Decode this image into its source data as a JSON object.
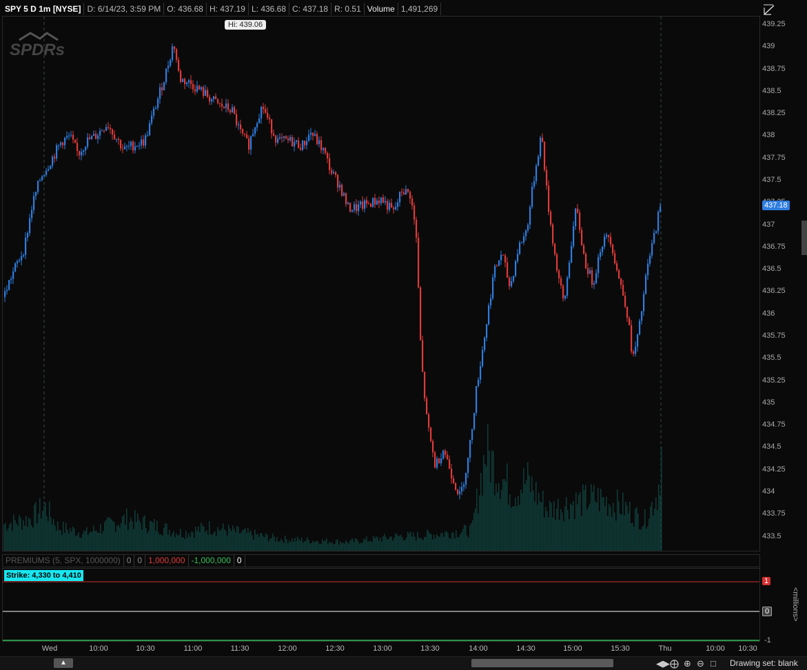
{
  "header": {
    "symbol": "SPY 5 D 1m [NYSE]",
    "date": "D: 6/14/23, 3:59 PM",
    "open": "O: 436.68",
    "high": "H: 437.19",
    "low": "L: 436.68",
    "close": "C: 437.18",
    "range": "R: 0.51",
    "volume_label": "Volume",
    "volume_value": "1,491,269"
  },
  "chart_data": {
    "type": "candlestick",
    "y_ticks": [
      "439.25",
      "439",
      "438.75",
      "438.5",
      "438.25",
      "438",
      "437.75",
      "437.5",
      "437.25",
      "437",
      "436.75",
      "436.5",
      "436.25",
      "436",
      "435.75",
      "435.5",
      "435.25",
      "435",
      "434.75",
      "434.5",
      "434.25",
      "434",
      "433.75",
      "433.5"
    ],
    "ylim": [
      433.35,
      439.35
    ],
    "x_labels": [
      "Wed",
      "10:00",
      "10:30",
      "11:00",
      "11:30",
      "12:00",
      "12:30",
      "13:00",
      "13:30",
      "14:00",
      "14:30",
      "15:00",
      "15:30",
      "Thu",
      "10:00",
      "10:30"
    ],
    "last_price": "437.18",
    "hi_label": "Hi: 439.06",
    "price_path": [
      [
        0,
        436.2
      ],
      [
        8,
        436.4
      ],
      [
        15,
        436.55
      ],
      [
        25,
        436.75
      ],
      [
        35,
        437.25
      ],
      [
        45,
        437.55
      ],
      [
        55,
        437.7
      ],
      [
        70,
        437.95
      ],
      [
        80,
        438.0
      ],
      [
        90,
        437.8
      ],
      [
        100,
        437.95
      ],
      [
        110,
        438.0
      ],
      [
        125,
        438.15
      ],
      [
        135,
        438.0
      ],
      [
        145,
        437.85
      ],
      [
        155,
        437.9
      ],
      [
        170,
        437.95
      ],
      [
        185,
        438.4
      ],
      [
        195,
        438.7
      ],
      [
        205,
        439.06
      ],
      [
        212,
        438.65
      ],
      [
        225,
        438.6
      ],
      [
        240,
        438.5
      ],
      [
        260,
        438.35
      ],
      [
        275,
        438.3
      ],
      [
        285,
        438.05
      ],
      [
        295,
        437.9
      ],
      [
        305,
        438.2
      ],
      [
        312,
        438.35
      ],
      [
        320,
        438.15
      ],
      [
        330,
        437.95
      ],
      [
        345,
        437.95
      ],
      [
        360,
        437.9
      ],
      [
        370,
        438.05
      ],
      [
        385,
        437.85
      ],
      [
        395,
        437.6
      ],
      [
        405,
        437.45
      ],
      [
        415,
        437.2
      ],
      [
        425,
        437.2
      ],
      [
        440,
        437.25
      ],
      [
        455,
        437.3
      ],
      [
        470,
        437.15
      ],
      [
        480,
        437.4
      ],
      [
        490,
        437.35
      ],
      [
        497,
        436.9
      ],
      [
        503,
        435.5
      ],
      [
        510,
        434.8
      ],
      [
        520,
        434.3
      ],
      [
        530,
        434.5
      ],
      [
        540,
        434.2
      ],
      [
        550,
        433.95
      ],
      [
        560,
        434.4
      ],
      [
        570,
        435.2
      ],
      [
        580,
        435.8
      ],
      [
        590,
        436.45
      ],
      [
        600,
        436.7
      ],
      [
        610,
        436.3
      ],
      [
        620,
        436.75
      ],
      [
        630,
        436.95
      ],
      [
        640,
        437.6
      ],
      [
        648,
        438.05
      ],
      [
        655,
        437.3
      ],
      [
        665,
        436.6
      ],
      [
        675,
        436.1
      ],
      [
        685,
        436.9
      ],
      [
        690,
        437.2
      ],
      [
        700,
        436.6
      ],
      [
        710,
        436.35
      ],
      [
        720,
        436.8
      ],
      [
        730,
        436.9
      ],
      [
        740,
        436.45
      ],
      [
        750,
        436.1
      ],
      [
        758,
        435.5
      ],
      [
        765,
        435.8
      ],
      [
        775,
        436.5
      ],
      [
        790,
        437.18
      ]
    ],
    "volume_path": [
      [
        0,
        45
      ],
      [
        40,
        55
      ],
      [
        60,
        75
      ],
      [
        80,
        40
      ],
      [
        120,
        30
      ],
      [
        180,
        55
      ],
      [
        260,
        30
      ],
      [
        300,
        40
      ],
      [
        400,
        20
      ],
      [
        500,
        15
      ],
      [
        540,
        20
      ],
      [
        575,
        25
      ],
      [
        600,
        25
      ],
      [
        640,
        30
      ],
      [
        680,
        35
      ],
      [
        700,
        170
      ],
      [
        720,
        130
      ],
      [
        740,
        100
      ],
      [
        760,
        120
      ],
      [
        790,
        70
      ],
      [
        820,
        80
      ],
      [
        860,
        90
      ],
      [
        900,
        75
      ],
      [
        930,
        50
      ],
      [
        950,
        100
      ],
      [
        955,
        170
      ],
      [
        958,
        50
      ]
    ]
  },
  "premiums": {
    "study": "PREMIUMS (5, SPX, 1000000)",
    "v1": "0",
    "v2": "0",
    "upper": "1,000,000",
    "lower": "-1,000,000",
    "zero": "0",
    "strike": "Strike: 4,330 to 4,410",
    "badge_top": "1",
    "badge_mid": "0",
    "badge_bot": "-1",
    "units": "<millions>"
  },
  "bottom": {
    "drawing_set": "Drawing set: blank"
  },
  "colors": {
    "up": "#2f7de0",
    "down": "#e03a3a",
    "volume": "#0f3b37",
    "cyan": "#18e6ef"
  }
}
